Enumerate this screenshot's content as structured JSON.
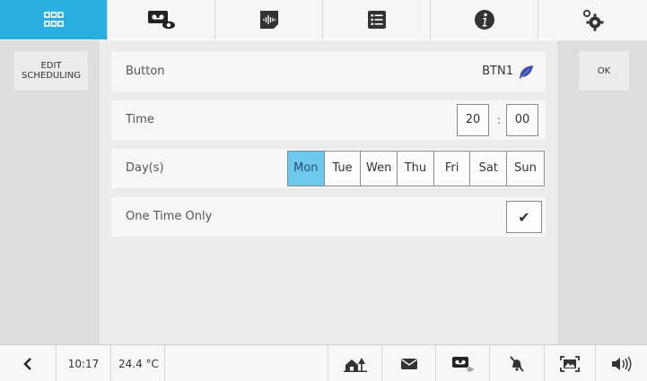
{
  "top_tabs": [
    {
      "name": "home-grid",
      "icon": "grid-icon",
      "active": true
    },
    {
      "name": "video-messages",
      "icon": "video-message-icon",
      "active": false
    },
    {
      "name": "intercom-audio",
      "icon": "audio-wave-icon",
      "active": false
    },
    {
      "name": "list",
      "icon": "list-icon",
      "active": false
    },
    {
      "name": "info",
      "icon": "info-icon",
      "active": false
    },
    {
      "name": "settings",
      "icon": "gears-icon",
      "active": false
    }
  ],
  "left_panel": {
    "edit_label": "EDIT\nSCHEDULING"
  },
  "right_panel": {
    "ok_label": "OK"
  },
  "form": {
    "button_label": "Button",
    "button_value": "BTN1",
    "button_icon": "leaf-icon",
    "time_label": "Time",
    "time_hour": "20",
    "time_separator": ":",
    "time_minute": "00",
    "days_label": "Day(s)",
    "days": [
      {
        "label": "Mon",
        "selected": true
      },
      {
        "label": "Tue",
        "selected": false
      },
      {
        "label": "Wen",
        "selected": false
      },
      {
        "label": "Thu",
        "selected": false
      },
      {
        "label": "Fri",
        "selected": false
      },
      {
        "label": "Sat",
        "selected": false
      },
      {
        "label": "Sun",
        "selected": false
      }
    ],
    "one_time_label": "One Time Only",
    "one_time_checked": true,
    "check_glyph": "✔"
  },
  "bottom_bar": {
    "back_icon": "chevron-left-icon",
    "clock": "10:17",
    "temperature": "24.4 °C",
    "icons": [
      "home-icon",
      "mail-icon",
      "voicemail-icon",
      "mute-bell-icon",
      "photo-icon",
      "volume-icon"
    ]
  },
  "colors": {
    "accent": "#29aee0",
    "selected_day": "#6ec8ec",
    "leaf": "#3b4fa8"
  }
}
